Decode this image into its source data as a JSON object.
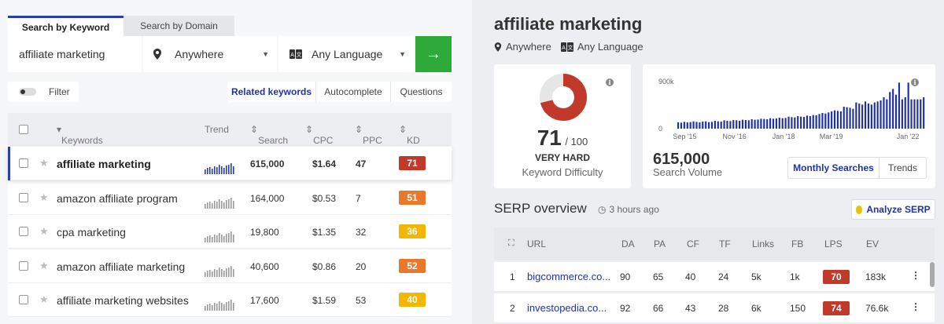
{
  "search": {
    "tabs": [
      {
        "label": "Search by Keyword"
      },
      {
        "label": "Search by Domain"
      }
    ],
    "query": "affiliate marketing",
    "location": "Anywhere",
    "language": "Any Language"
  },
  "filter_label": "Filter",
  "segments": [
    {
      "label": "Related keywords"
    },
    {
      "label": "Autocomplete"
    },
    {
      "label": "Questions"
    }
  ],
  "table": {
    "headers": {
      "keywords": "Keywords",
      "trend": "Trend",
      "search": "Search",
      "cpc": "CPC",
      "ppc": "PPC",
      "kd": "KD"
    },
    "rows": [
      {
        "keyword": "affiliate marketing",
        "search": "615,000",
        "cpc": "$1.64",
        "ppc": "47",
        "kd": "71",
        "kd_color": "#c0392b"
      },
      {
        "keyword": "amazon affiliate program",
        "search": "164,000",
        "cpc": "$0.53",
        "ppc": "7",
        "kd": "51",
        "kd_color": "#e8792b"
      },
      {
        "keyword": "cpa marketing",
        "search": "19,800",
        "cpc": "$1.35",
        "ppc": "32",
        "kd": "36",
        "kd_color": "#f2b705"
      },
      {
        "keyword": "amazon affiliate marketing",
        "search": "40,600",
        "cpc": "$0.86",
        "ppc": "20",
        "kd": "52",
        "kd_color": "#e8792b"
      },
      {
        "keyword": "affiliate marketing websites",
        "search": "17,600",
        "cpc": "$1.59",
        "ppc": "53",
        "kd": "40",
        "kd_color": "#f2b705"
      }
    ]
  },
  "detail": {
    "title": "affiliate marketing",
    "location": "Anywhere",
    "language": "Any Language",
    "kd_value": "71",
    "kd_max": "/ 100",
    "kd_level": "VERY HARD",
    "kd_label": "Keyword Difficulty",
    "kd_fraction": 0.71,
    "kd_color": "#c0392b",
    "volume_value": "615,000",
    "volume_label": "Search Volume",
    "volume_toggle": [
      {
        "label": "Monthly Searches"
      },
      {
        "label": "Trends"
      }
    ]
  },
  "chart_data": {
    "type": "bar",
    "title": "",
    "y_ticks": [
      "900k",
      "0"
    ],
    "x_ticks": [
      "Sep '15",
      "Nov '16",
      "Jan '18",
      "Mar '19",
      "Jan '22"
    ],
    "ylim": [
      0,
      900000
    ],
    "values": [
      120000,
      115000,
      130000,
      120000,
      125000,
      140000,
      130000,
      120000,
      135000,
      140000,
      125000,
      130000,
      150000,
      140000,
      135000,
      160000,
      150000,
      145000,
      165000,
      160000,
      150000,
      170000,
      165000,
      160000,
      180000,
      170000,
      175000,
      190000,
      185000,
      180000,
      200000,
      190000,
      195000,
      210000,
      200000,
      205000,
      230000,
      220000,
      215000,
      240000,
      230000,
      225000,
      250000,
      240000,
      260000,
      255000,
      280000,
      300000,
      290000,
      310000,
      330000,
      350000,
      340000,
      330000,
      420000,
      410000,
      400000,
      380000,
      500000,
      480000,
      460000,
      520000,
      480000,
      460000,
      500000,
      520000,
      540000,
      600000,
      560000,
      700000,
      760000,
      650000,
      880000,
      560000,
      600000,
      880000,
      560000,
      560000,
      560000,
      560000,
      600000
    ]
  },
  "serp": {
    "title": "SERP overview",
    "updated": "3 hours ago",
    "analyze_label": "Analyze SERP",
    "headers": {
      "url": "URL",
      "da": "DA",
      "pa": "PA",
      "cf": "CF",
      "tf": "TF",
      "links": "Links",
      "fb": "FB",
      "lps": "LPS",
      "ev": "EV"
    },
    "rows": [
      {
        "rank": "1",
        "url": "bigcommerce.co...",
        "da": "90",
        "pa": "65",
        "cf": "40",
        "tf": "24",
        "links": "5k",
        "fb": "1k",
        "lps": "70",
        "ev": "183k"
      },
      {
        "rank": "2",
        "url": "investopedia.co...",
        "da": "92",
        "pa": "66",
        "cf": "43",
        "tf": "28",
        "links": "6k",
        "fb": "150",
        "lps": "74",
        "ev": "76.6k"
      }
    ]
  }
}
